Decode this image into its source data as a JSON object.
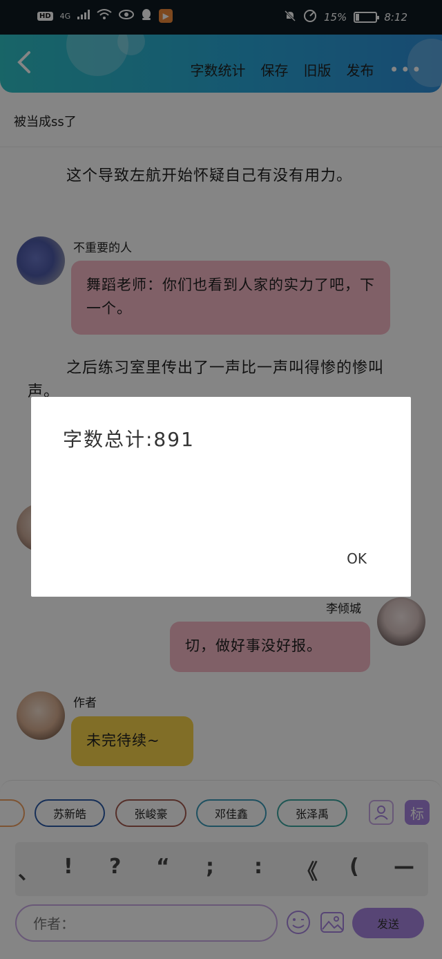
{
  "status_bar": {
    "left_badges": [
      "HD",
      "4G"
    ],
    "battery_text": "15%",
    "battery_level": 0.15,
    "time": "8:12"
  },
  "header": {
    "actions": [
      "字数统计",
      "保存",
      "旧版",
      "发布"
    ]
  },
  "subtitle": "被当成ss了",
  "paragraphs": [
    "这个导致左航开始怀疑自己有没有用力。",
    "之后练习室里传出了一声比一声叫得惨的惨叫声。"
  ],
  "messages": [
    {
      "name": "不重要的人",
      "text": "舞蹈老师：你们也看到人家的实力了吧，下一个。"
    },
    {
      "name": "李倾城",
      "text": "切，做好事没好报。"
    },
    {
      "name": "作者",
      "text": "未完待续~"
    }
  ],
  "dialog": {
    "message": "字数总计:891",
    "ok_label": "OK"
  },
  "characters": [
    "苏新皓",
    "张峻豪",
    "邓佳鑫",
    "张泽禹"
  ],
  "panel_right_badge": "标",
  "punctuation": [
    "、",
    "!",
    "?",
    "“",
    ";",
    ":",
    "《",
    "(",
    "—"
  ],
  "input": {
    "placeholder": "作者："
  },
  "send_label": "发送",
  "colors": {
    "header_start": "#2ec1c6",
    "header_end": "#2e8fd8",
    "pink_bubble": "#f6b8c6",
    "yellow_bubble": "#f7d44c",
    "send_button": "#a884e0"
  }
}
